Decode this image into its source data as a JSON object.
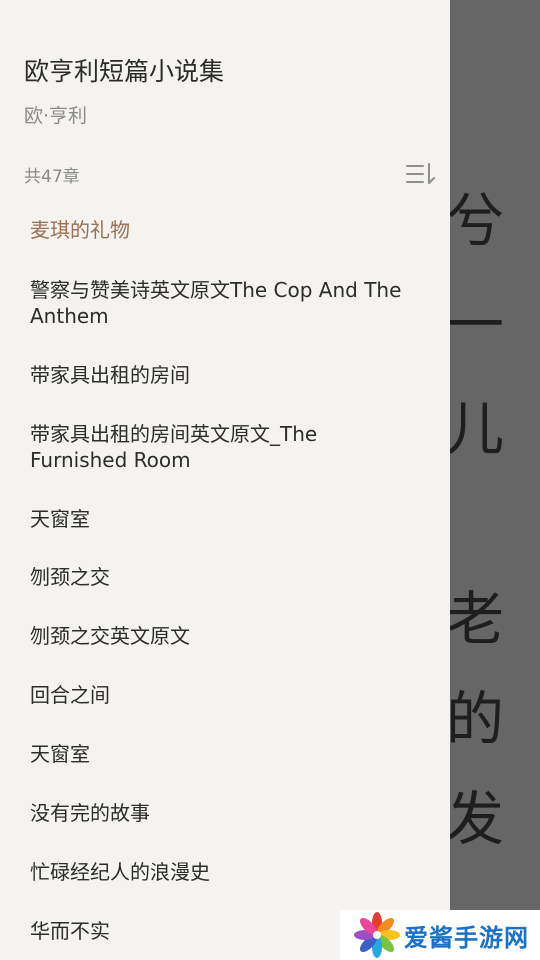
{
  "drawer": {
    "book_title": "欧亨利短篇小说集",
    "author": "欧·亨利",
    "chapter_count": "共47章",
    "sort_icon": "sort-list-icon",
    "chapters": [
      {
        "label": "麦琪的礼物",
        "active": true
      },
      {
        "label": "警察与赞美诗英文原文The Cop And The Anthem"
      },
      {
        "label": "带家具出租的房间"
      },
      {
        "label": "带家具出租的房间英文原文_The Furnished Room"
      },
      {
        "label": "天窗室"
      },
      {
        "label": "刎颈之交"
      },
      {
        "label": "刎颈之交英文原文"
      },
      {
        "label": "回合之间"
      },
      {
        "label": "天窗室"
      },
      {
        "label": "没有完的故事"
      },
      {
        "label": "忙碌经纪人的浪漫史"
      },
      {
        "label": "华而不实"
      }
    ]
  },
  "reader": {
    "glyphs": [
      "兮",
      "一",
      "儿",
      "老",
      "的",
      "发"
    ]
  },
  "watermark": {
    "text": "爱酱手游网"
  },
  "colors": {
    "drawer_bg": "#f4f3ef",
    "active_chapter": "#9a6f53",
    "overlay": "#666666",
    "watermark_text": "#1a72c8"
  }
}
